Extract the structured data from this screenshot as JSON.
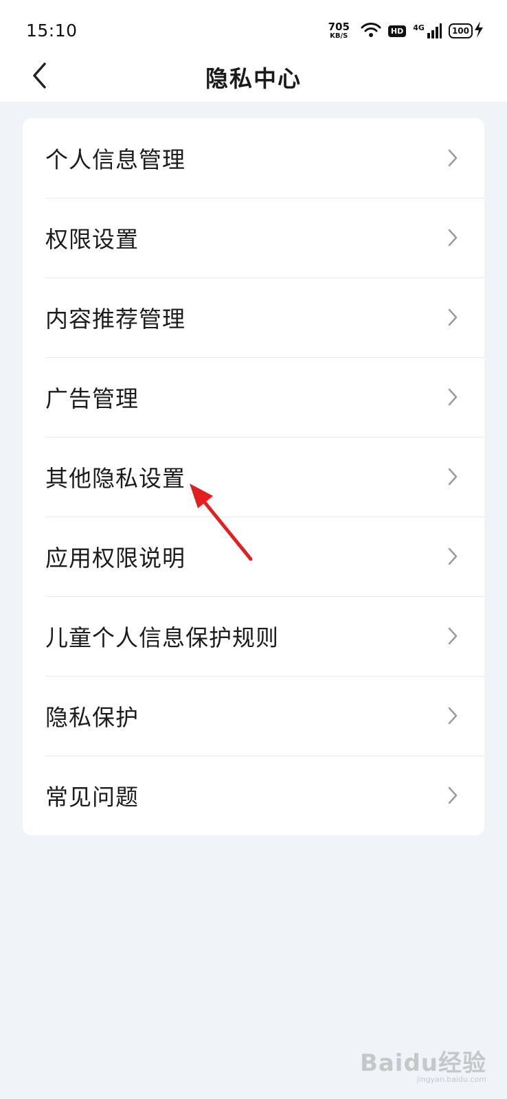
{
  "status_bar": {
    "time": "15:10",
    "net_speed_value": "705",
    "net_speed_unit": "KB/S",
    "hd_badge": "HD",
    "signal_label": "4G",
    "battery_level": "100",
    "icons": [
      "wifi-icon",
      "signal-icon",
      "battery-icon",
      "charging-icon"
    ]
  },
  "header": {
    "title": "隐私中心",
    "back_icon": "chevron-left-icon"
  },
  "menu": {
    "items": [
      {
        "label": "个人信息管理"
      },
      {
        "label": "权限设置"
      },
      {
        "label": "内容推荐管理"
      },
      {
        "label": "广告管理"
      },
      {
        "label": "其他隐私设置"
      },
      {
        "label": "应用权限说明"
      },
      {
        "label": "儿童个人信息保护规则"
      },
      {
        "label": "隐私保护"
      },
      {
        "label": "常见问题"
      }
    ],
    "item_icon": "chevron-right-icon"
  },
  "annotation": {
    "arrow_color": "#e3201f",
    "target": "其他隐私设置"
  },
  "watermark": {
    "brand": "Baidu经验",
    "url": "jingyan.baidu.com"
  },
  "colors": {
    "page_background": "#f0f3f8",
    "card_background": "#ffffff",
    "divider": "#e9ebef",
    "chevron": "#9a9a9a"
  }
}
